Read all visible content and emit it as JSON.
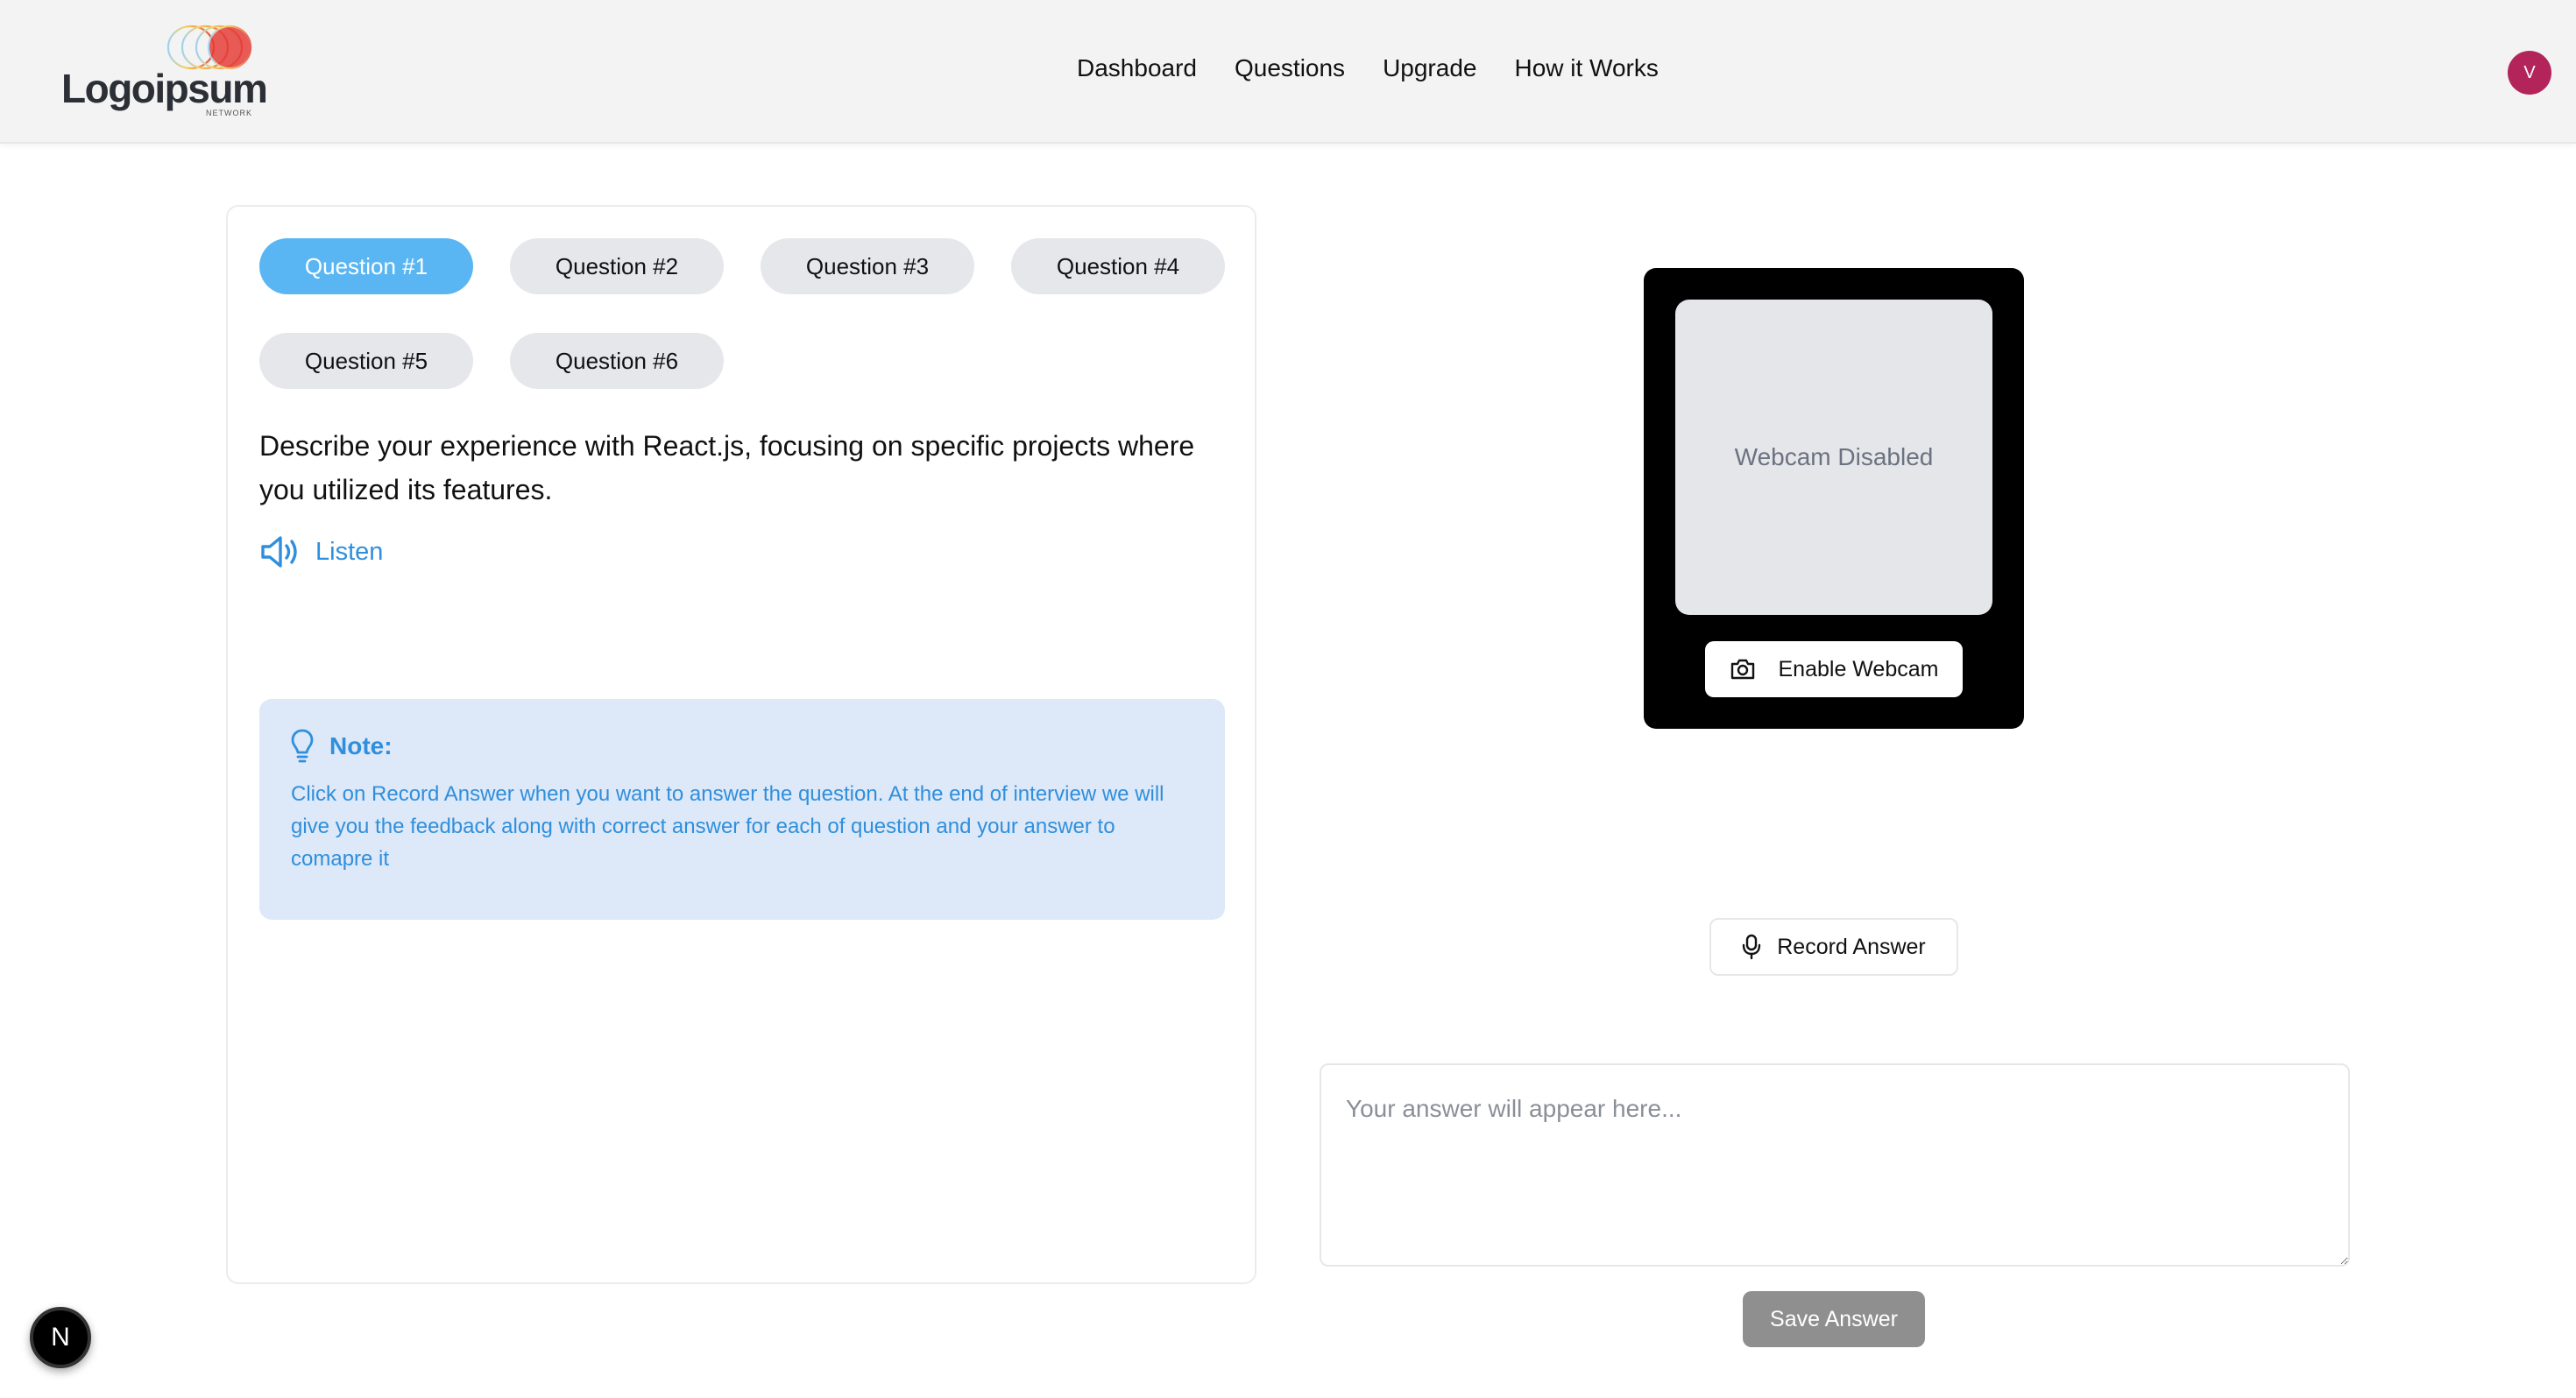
{
  "header": {
    "logo_text": "Logoipsum",
    "logo_sub": "NETWORK",
    "nav": [
      "Dashboard",
      "Questions",
      "Upgrade",
      "How it Works"
    ],
    "avatar_initial": "V"
  },
  "questions": {
    "tabs": [
      "Question #1",
      "Question #2",
      "Question #3",
      "Question #4",
      "Question #5",
      "Question #6"
    ],
    "active_index": 0,
    "current_text": "Describe your experience with React.js, focusing on specific projects where you utilized its features.",
    "listen_label": "Listen"
  },
  "note": {
    "title": "Note:",
    "body": "Click on Record Answer when you want to answer the question. At the end of interview we will give you the feedback along with correct answer for each of question and your answer to comapre it"
  },
  "webcam": {
    "status": "Webcam Disabled",
    "enable_label": "Enable Webcam"
  },
  "record": {
    "label": "Record Answer"
  },
  "answer": {
    "value": "",
    "placeholder": "Your answer will appear here..."
  },
  "save": {
    "label": "Save Answer"
  },
  "dev_badge": {
    "label": "N"
  },
  "colors": {
    "accent": "#5ab6f2",
    "note_bg": "#dde8f8",
    "note_text": "#2f8fdc",
    "avatar": "#b3245a",
    "save_disabled": "#8f8f8f"
  }
}
